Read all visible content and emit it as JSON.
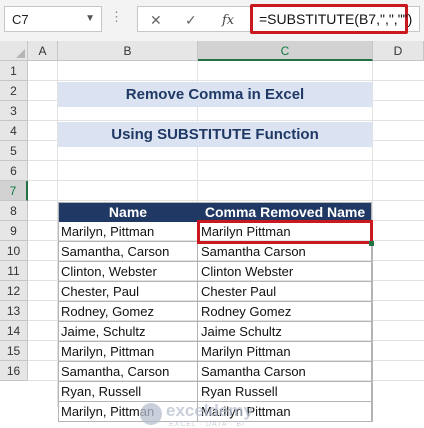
{
  "formula_bar": {
    "name_box": "C7",
    "cancel_icon": "✕",
    "enter_icon": "✓",
    "fx_label": "fx",
    "formula": "=SUBSTITUTE(B7,\",\",\"\")"
  },
  "columns": [
    "A",
    "B",
    "C",
    "D"
  ],
  "rows": [
    "1",
    "2",
    "3",
    "4",
    "5",
    "6",
    "7",
    "8",
    "9",
    "10",
    "11",
    "12",
    "13",
    "14",
    "15",
    "16"
  ],
  "title": "Remove Comma in Excel",
  "subtitle": "Using SUBSTITUTE Function",
  "table": {
    "headers": [
      "Name",
      "Comma Removed Name"
    ],
    "rows": [
      [
        "Marilyn, Pittman",
        "Marilyn Pittman"
      ],
      [
        "Samantha, Carson",
        "Samantha Carson"
      ],
      [
        "Clinton, Webster",
        "Clinton Webster"
      ],
      [
        "Chester, Paul",
        "Chester Paul"
      ],
      [
        "Rodney, Gomez",
        "Rodney Gomez"
      ],
      [
        "Jaime, Schultz",
        "Jaime Schultz"
      ],
      [
        "Marilyn, Pittman",
        "Marilyn Pittman"
      ],
      [
        "Samantha, Carson",
        "Samantha Carson"
      ],
      [
        "Ryan, Russell",
        "Ryan Russell"
      ],
      [
        "Marilyn, Pittman",
        "Marilyn Pittman"
      ]
    ]
  },
  "watermark": {
    "name": "exceldemy",
    "tagline": "EXCEL · DATA · BI"
  },
  "colors": {
    "accent_red": "#c9191e",
    "header_navy": "#1f3864",
    "banner_bg": "#dbe3f3",
    "excel_green": "#217346"
  }
}
